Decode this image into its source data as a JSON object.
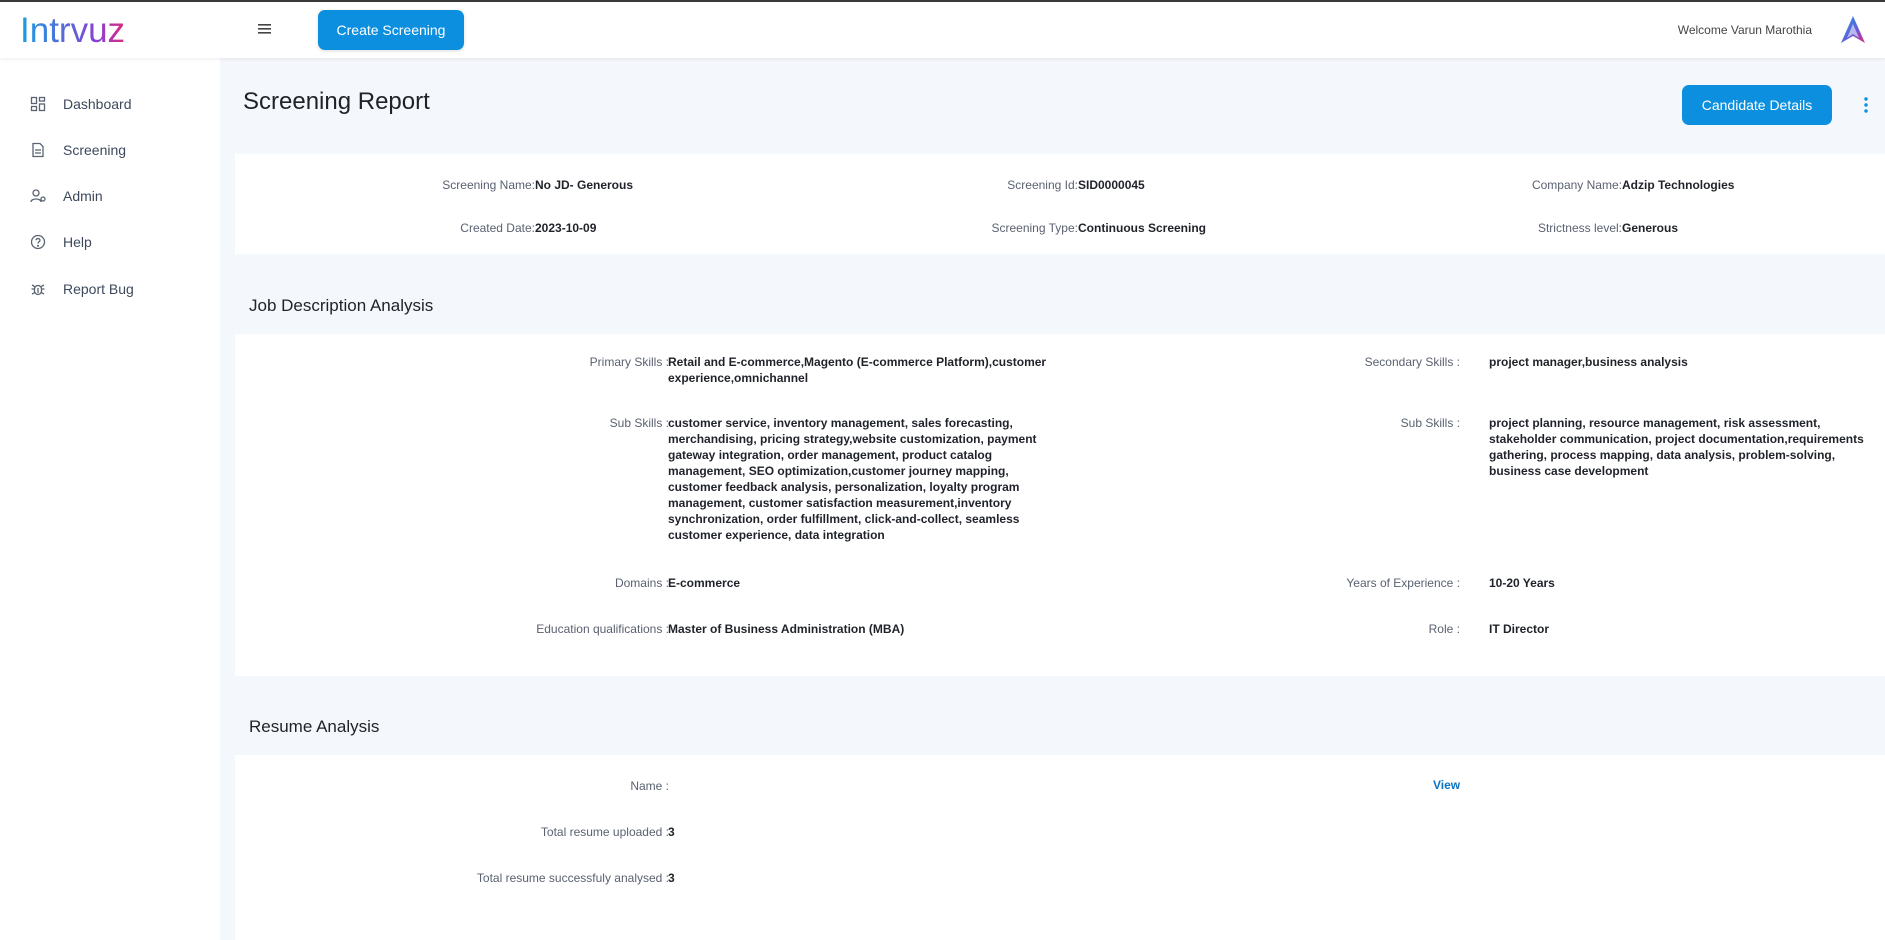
{
  "header": {
    "logo_text": "Intrvuz",
    "create_button": "Create Screening",
    "welcome": "Welcome Varun Marothia"
  },
  "sidebar": {
    "items": [
      {
        "label": "Dashboard",
        "icon": "dashboard-icon"
      },
      {
        "label": "Screening",
        "icon": "document-icon"
      },
      {
        "label": "Admin",
        "icon": "user-gear-icon"
      },
      {
        "label": "Help",
        "icon": "help-circle-icon"
      },
      {
        "label": "Report Bug",
        "icon": "bug-icon"
      }
    ]
  },
  "page": {
    "title": "Screening Report",
    "candidate_button": "Candidate Details"
  },
  "info": {
    "screening_name_label": "Screening Name:",
    "screening_name": "No JD- Generous",
    "screening_id_label": "Screening Id:",
    "screening_id": "SID0000045",
    "company_name_label": "Company Name:",
    "company_name": "Adzip Technologies",
    "created_date_label": "Created Date:",
    "created_date": "2023-10-09",
    "screening_type_label": "Screening Type:",
    "screening_type": "Continuous Screening",
    "strictness_label": "Strictness level:",
    "strictness": "Generous"
  },
  "jd": {
    "title": "Job Description Analysis",
    "primary_skills_label": "Primary Skills :",
    "primary_skills": "Retail and E-commerce,Magento (E-commerce Platform),customer experience,omnichannel",
    "secondary_skills_label": "Secondary Skills :",
    "secondary_skills": "project manager,business analysis",
    "sub_skills_label": "Sub Skills :",
    "sub_skills_primary": "customer service, inventory management, sales forecasting, merchandising, pricing strategy,website customization, payment gateway integration, order management, product catalog management, SEO optimization,customer journey mapping, customer feedback analysis, personalization, loyalty program management, customer satisfaction measurement,inventory synchronization, order fulfillment, click-and-collect, seamless customer experience, data integration",
    "sub_skills_secondary_label": "Sub Skills :",
    "sub_skills_secondary": "project planning, resource management, risk assessment, stakeholder communication, project documentation,requirements gathering, process mapping, data analysis, problem-solving, business case development",
    "domains_label": "Domains :",
    "domains": "E-commerce",
    "experience_label": "Years of Experience :",
    "experience": "10-20 Years",
    "education_label": "Education qualifications :",
    "education": "Master of Business Administration (MBA)",
    "role_label": "Role :",
    "role": "IT Director"
  },
  "resume": {
    "title": "Resume Analysis",
    "name_label": "Name :",
    "view_link": "View",
    "uploaded_label": "Total resume uploaded :",
    "uploaded": "3",
    "analysed_label": "Total resume successfuly analysed :",
    "analysed": "3"
  },
  "colors": {
    "primary": "#0b8fde",
    "logo_blue": "#1a9fe0",
    "logo_purple": "#8a3fd1",
    "logo_pink": "#e0297a"
  }
}
